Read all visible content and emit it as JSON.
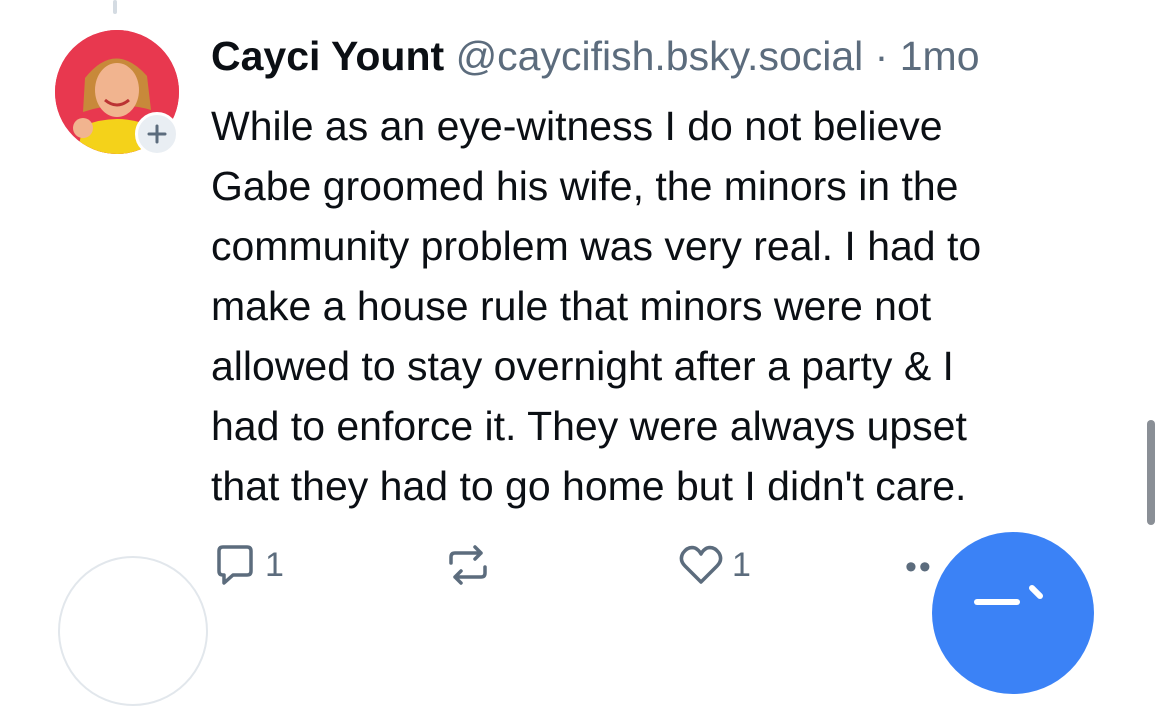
{
  "post": {
    "author_name": "Cayci Yount",
    "handle": "@caycifish.bsky.social",
    "separator": "·",
    "timestamp": "1mo",
    "text": "While as an eye-witness I do not believe\nGabe groomed his wife, the minors in the\ncommunity problem was very real. I had to\nmake a house rule that minors were not\nallowed to stay overnight after a party & I\nhad to enforce it. They were always upset\nthat they had to go home but I didn't care.",
    "avatar_icon": "profile-photo",
    "follow_icon": "plus-icon"
  },
  "actions": {
    "reply_count": "1",
    "repost_count": "",
    "like_count": "1",
    "more_label": "••"
  },
  "colors": {
    "accent": "#3b82f6",
    "muted": "#5c6c7d",
    "avatar_bg": "#e8384f"
  }
}
